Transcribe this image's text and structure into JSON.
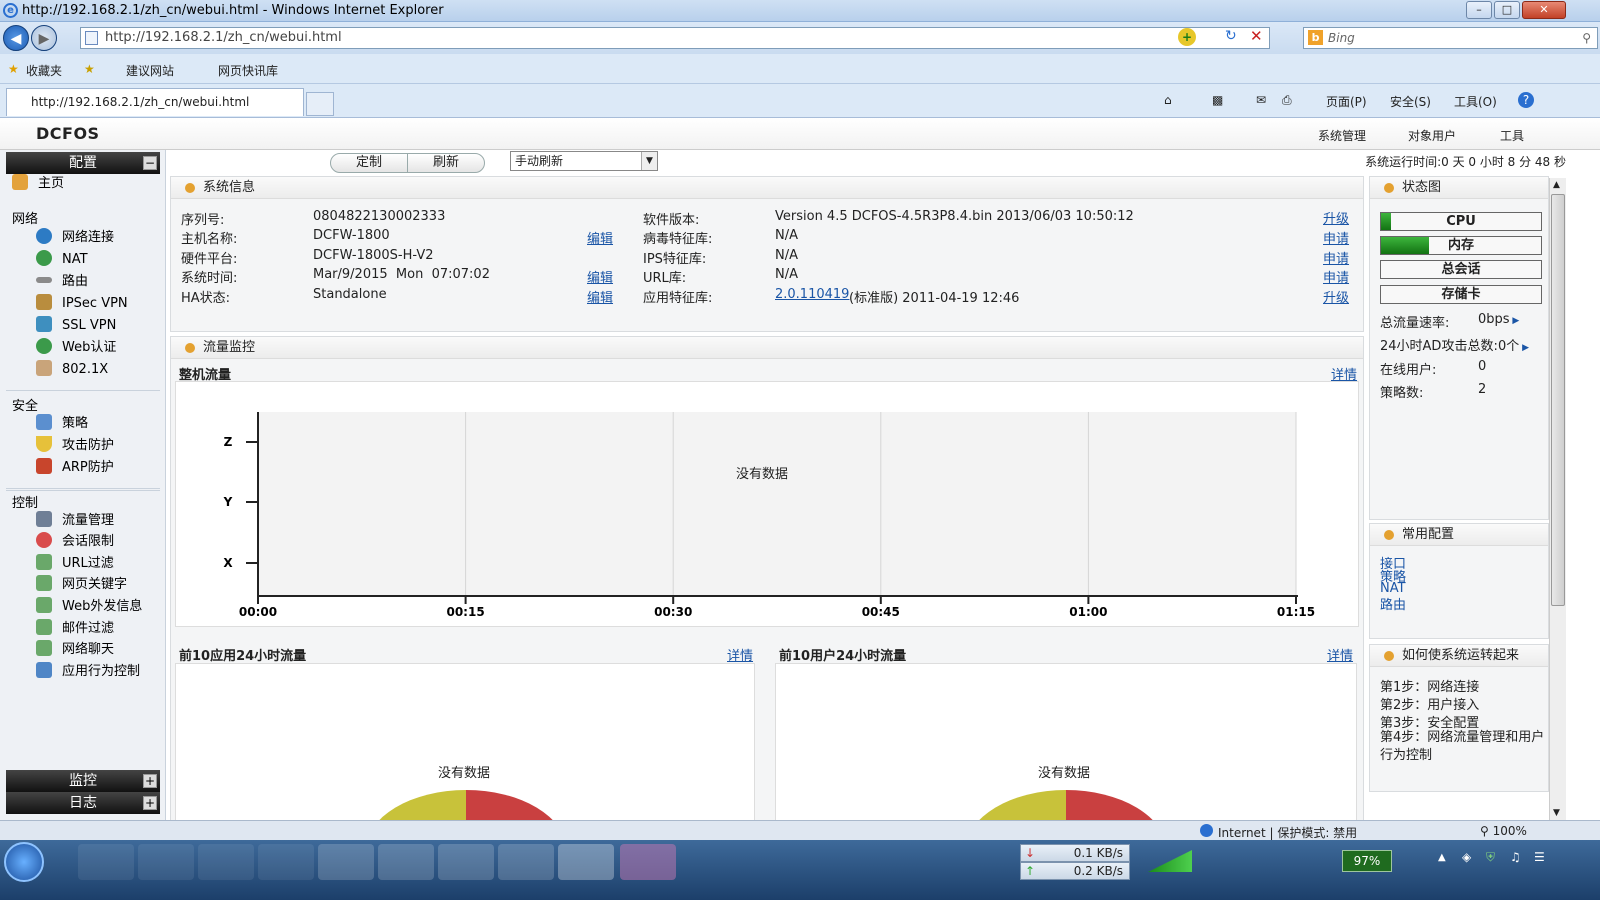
{
  "window": {
    "title": "http://192.168.2.1/zh_cn/webui.html - Windows Internet Explorer",
    "min": "–",
    "max": "□",
    "close": "✕"
  },
  "browser": {
    "address": "http://192.168.2.1/zh_cn/webui.html",
    "search_placeholder": "Bing",
    "favorites": "收藏夹",
    "suggested": "建议网站",
    "webslice": "网页快讯库",
    "tab_title": "http://192.168.2.1/zh_cn/webui.html",
    "page_menu": "页面(P)",
    "safety_menu": "安全(S)",
    "tools_menu": "工具(O)",
    "help_icon": "?"
  },
  "app": {
    "logo": "DCFOS",
    "menu": [
      "系统管理",
      "对象用户",
      "工具"
    ]
  },
  "sidebar": {
    "config": "配置",
    "home": "主页",
    "groups": [
      {
        "title": "网络",
        "items": [
          "网络连接",
          "NAT",
          "路由",
          "IPSec VPN",
          "SSL VPN",
          "Web认证",
          "802.1X"
        ]
      },
      {
        "title": "安全",
        "items": [
          "策略",
          "攻击防护",
          "ARP防护"
        ]
      },
      {
        "title": "控制",
        "items": [
          "流量管理",
          "会话限制",
          "URL过滤",
          "网页关键字",
          "Web外发信息",
          "邮件过滤",
          "网络聊天",
          "应用行为控制"
        ]
      }
    ],
    "monitor": "监控",
    "log": "日志"
  },
  "toolbar": {
    "customize": "定制",
    "refresh": "刷新",
    "refresh_mode": "手动刷新",
    "uptime": "系统运行时间:0 天 0 小时 8 分 48 秒"
  },
  "sysinfo": {
    "title": "系统信息",
    "left": [
      [
        "序列号:",
        "0804822130002333",
        ""
      ],
      [
        "主机名称:",
        "DCFW-1800",
        "编辑"
      ],
      [
        "硬件平台:",
        "DCFW-1800S-H-V2",
        ""
      ],
      [
        "系统时间:",
        "Mar/9/2015  Mon  07:07:02",
        "编辑"
      ],
      [
        "HA状态:",
        "Standalone",
        "编辑"
      ]
    ],
    "right": [
      [
        "软件版本:",
        "Version 4.5 DCFOS-4.5R3P8.4.bin 2013/06/03 10:50:12",
        "升级"
      ],
      [
        "病毒特征库:",
        "N/A",
        "申请"
      ],
      [
        "IPS特征库:",
        "N/A",
        "申请"
      ],
      [
        "URL库:",
        "N/A",
        "申请"
      ],
      [
        "应用特征库:",
        "(标准版) 2011-04-19 12:46",
        "升级"
      ]
    ],
    "app_sig_version": "2.0.110419"
  },
  "traffic": {
    "title": "流量监控",
    "sub": "整机流量",
    "detail": "详情",
    "no_data": "没有数据",
    "yticks": [
      "Z",
      "Y",
      "X"
    ],
    "xticks": [
      "00:00",
      "00:15",
      "00:30",
      "00:45",
      "01:00",
      "01:15"
    ]
  },
  "top_apps": {
    "title": "前10应用24小时流量",
    "detail": "详情",
    "no_data": "没有数据"
  },
  "top_users": {
    "title": "前10用户24小时流量",
    "detail": "详情",
    "no_data": "没有数据"
  },
  "status": {
    "title": "状态图",
    "bars": [
      {
        "label": "CPU",
        "fill": 0.06
      },
      {
        "label": "内存",
        "fill": 0.3
      },
      {
        "label": "总会话",
        "fill": 0
      },
      {
        "label": "存储卡",
        "fill": 0
      }
    ],
    "stats": [
      [
        "总流量速率:",
        "0bps"
      ],
      [
        "24小时AD攻击总数:",
        "0个"
      ],
      [
        "在线用户:",
        "0"
      ],
      [
        "策略数:",
        "2"
      ]
    ]
  },
  "common": {
    "title": "常用配置",
    "links": [
      "接口",
      "策略",
      "NAT",
      "路由"
    ]
  },
  "howto": {
    "title": "如何使系统运转起来",
    "steps": [
      "第1步：网络连接",
      "第2步：用户接入",
      "第3步：安全配置",
      "第4步：网络流量管理和用户行为控制"
    ]
  },
  "statusbar": {
    "zone": "Internet | 保护模式: 禁用",
    "zoom": "100%"
  },
  "taskbar": {
    "down": "0.1 KB/s",
    "up": "0.2 KB/s",
    "battery": "97%"
  },
  "colors": {
    "pie_left": "#c8c23a",
    "pie_right": "#c94040",
    "accent": "#e4a130"
  }
}
